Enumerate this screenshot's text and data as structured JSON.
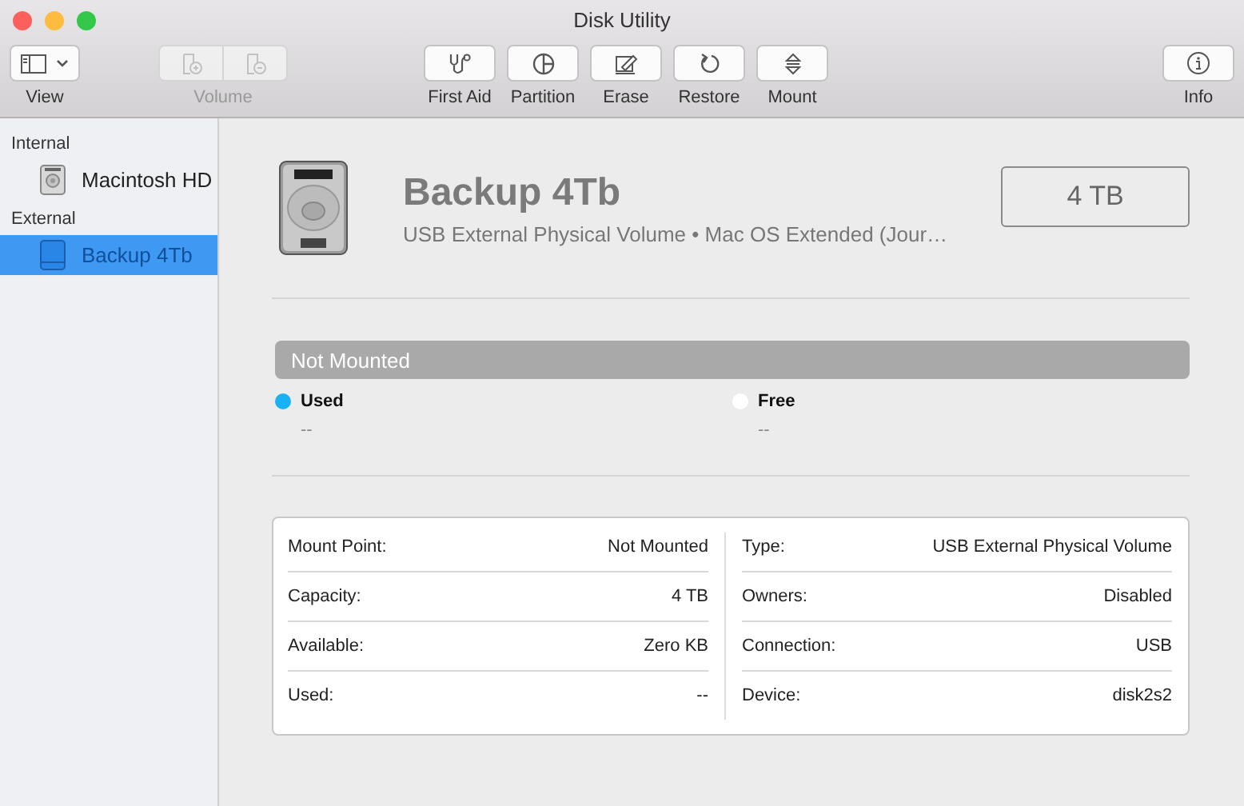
{
  "window": {
    "title": "Disk Utility"
  },
  "toolbar": [
    {
      "kind": "view",
      "label": "View",
      "disabled": false
    },
    {
      "kind": "volume",
      "label": "Volume",
      "disabled": true
    },
    {
      "kind": "firstaid",
      "label": "First Aid",
      "disabled": false
    },
    {
      "kind": "partition",
      "label": "Partition",
      "disabled": false
    },
    {
      "kind": "erase",
      "label": "Erase",
      "disabled": false
    },
    {
      "kind": "restore",
      "label": "Restore",
      "disabled": false
    },
    {
      "kind": "mount",
      "label": "Mount",
      "disabled": false
    },
    {
      "kind": "info",
      "label": "Info",
      "disabled": false
    }
  ],
  "sidebar": {
    "sections": [
      {
        "title": "Internal",
        "items": [
          {
            "label": "Macintosh HD",
            "kind": "internal",
            "selected": false
          }
        ]
      },
      {
        "title": "External",
        "items": [
          {
            "label": "Backup 4Tb",
            "kind": "external",
            "selected": true
          }
        ]
      }
    ]
  },
  "volume": {
    "name": "Backup 4Tb",
    "description": "USB External Physical Volume • Mac OS Extended (Jour…",
    "size": "4 TB"
  },
  "usage": {
    "label": "Not Mounted",
    "legend": [
      {
        "label": "Used",
        "value": "--",
        "color": "#1ab1f2"
      },
      {
        "label": "Free",
        "value": "--",
        "color": "#ffffff"
      }
    ]
  },
  "details": {
    "left": [
      {
        "label": "Mount Point:",
        "value": "Not Mounted"
      },
      {
        "label": "Capacity:",
        "value": "4 TB"
      },
      {
        "label": "Available:",
        "value": "Zero KB"
      },
      {
        "label": "Used:",
        "value": "--"
      }
    ],
    "right": [
      {
        "label": "Type:",
        "value": "USB External Physical Volume"
      },
      {
        "label": "Owners:",
        "value": "Disabled"
      },
      {
        "label": "Connection:",
        "value": "USB"
      },
      {
        "label": "Device:",
        "value": "disk2s2"
      }
    ]
  }
}
